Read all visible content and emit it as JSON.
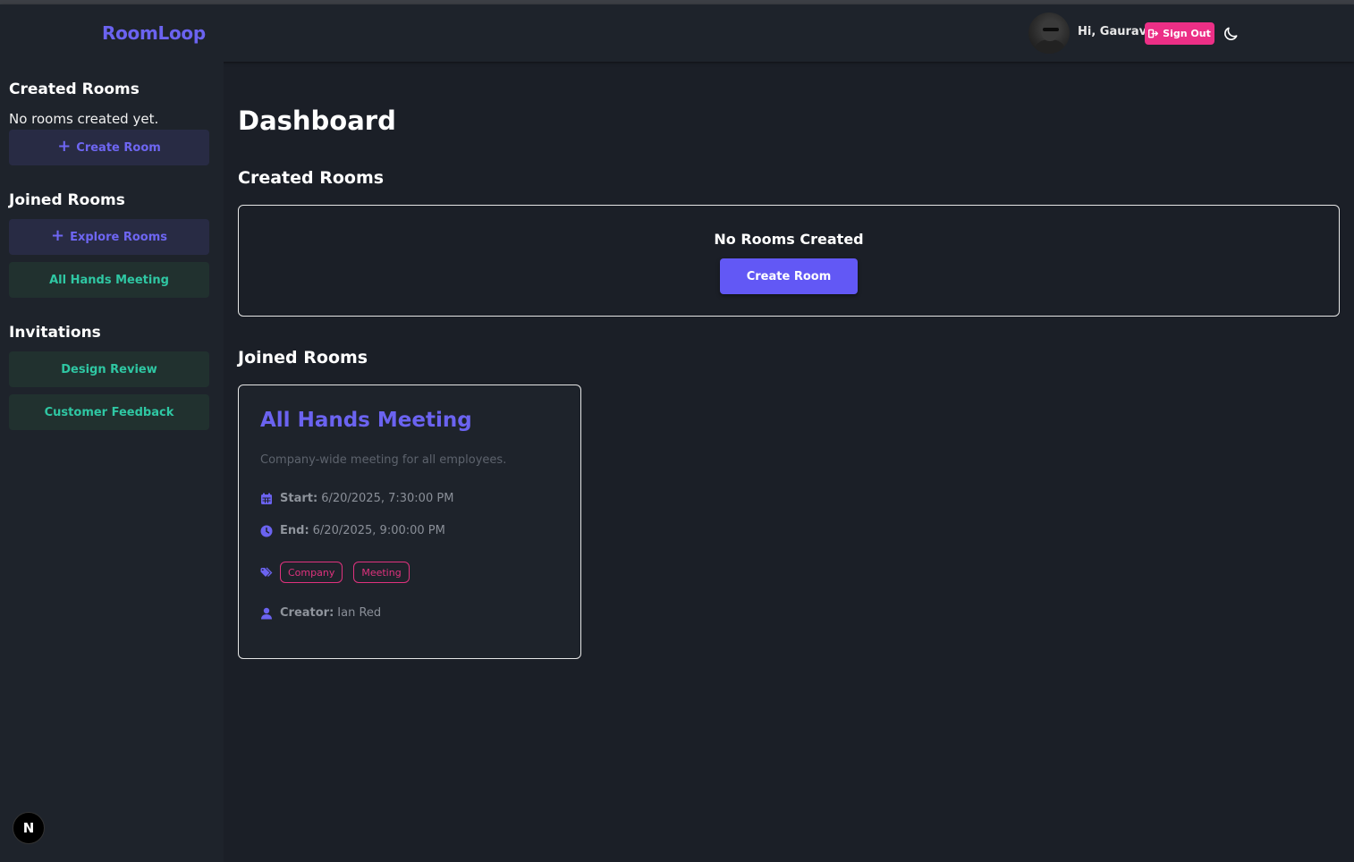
{
  "header": {
    "brand": "RoomLoop",
    "greeting": "Hi, Gaurav",
    "sign_out_label": "Sign Out"
  },
  "sidebar": {
    "created_title": "Created Rooms",
    "no_rooms_text": "No rooms created yet.",
    "create_room_label": "Create Room",
    "joined_title": "Joined Rooms",
    "explore_label": "Explore Rooms",
    "joined_items": [
      "All Hands Meeting"
    ],
    "invitations_title": "Invitations",
    "invitations": [
      "Design Review",
      "Customer Feedback"
    ],
    "badge_letter": "N"
  },
  "main": {
    "title": "Dashboard",
    "created_section": "Created Rooms",
    "no_rooms_created": "No Rooms Created",
    "create_room_button": "Create Room",
    "joined_section": "Joined Rooms",
    "card": {
      "title": "All Hands Meeting",
      "description": "Company-wide meeting for all employees.",
      "start_label": "Start:",
      "start_value": "6/20/2025, 7:30:00 PM",
      "end_label": "End:",
      "end_value": "6/20/2025, 9:00:00 PM",
      "tags": [
        "Company",
        "Meeting"
      ],
      "creator_label": "Creator:",
      "creator_value": "Ian Red"
    }
  },
  "colors": {
    "accent": "#6b63f0",
    "pink": "#ec2f86",
    "teal": "#2fc7a3",
    "background": "#1b1f27",
    "panel": "#1e232b"
  }
}
